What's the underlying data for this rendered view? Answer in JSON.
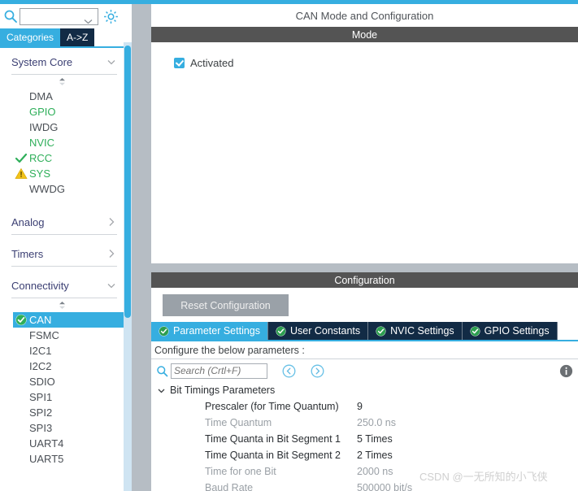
{
  "theme": {
    "accent": "#36aee0",
    "tab_dark": "#122b45",
    "section_bar": "#545454",
    "divider": "#b6bdc4",
    "green": "#2faf5a",
    "warning": "#f0c419"
  },
  "sidebar": {
    "search": {
      "value": "",
      "placeholder": ""
    },
    "gear_icon": "gear-icon",
    "tabs": [
      {
        "label": "Categories",
        "active": true
      },
      {
        "label": "A->Z",
        "active": false
      }
    ],
    "groups": [
      {
        "name": "System Core",
        "expanded": true,
        "items": [
          {
            "label": "DMA",
            "state": "none",
            "color": "#4a4f55"
          },
          {
            "label": "GPIO",
            "state": "none",
            "color": "#2faf5a"
          },
          {
            "label": "IWDG",
            "state": "none",
            "color": "#4a4f55"
          },
          {
            "label": "NVIC",
            "state": "none",
            "color": "#2faf5a"
          },
          {
            "label": "RCC",
            "state": "check",
            "color": "#2faf5a"
          },
          {
            "label": "SYS",
            "state": "warning",
            "color": "#2faf5a"
          },
          {
            "label": "WWDG",
            "state": "none",
            "color": "#4a4f55"
          }
        ]
      },
      {
        "name": "Analog",
        "expanded": false,
        "items": []
      },
      {
        "name": "Timers",
        "expanded": false,
        "items": []
      },
      {
        "name": "Connectivity",
        "expanded": true,
        "items": [
          {
            "label": "CAN",
            "state": "check-filled",
            "selected": true
          },
          {
            "label": "FSMC",
            "state": "none"
          },
          {
            "label": "I2C1",
            "state": "none"
          },
          {
            "label": "I2C2",
            "state": "none"
          },
          {
            "label": "SDIO",
            "state": "none"
          },
          {
            "label": "SPI1",
            "state": "none"
          },
          {
            "label": "SPI2",
            "state": "none"
          },
          {
            "label": "SPI3",
            "state": "none"
          },
          {
            "label": "UART4",
            "state": "none"
          },
          {
            "label": "UART5",
            "state": "none"
          }
        ]
      }
    ]
  },
  "main": {
    "title": "CAN Mode and Configuration",
    "mode": {
      "header": "Mode",
      "activated": {
        "label": "Activated",
        "checked": true
      }
    },
    "configuration": {
      "header": "Configuration",
      "reset_button": "Reset Configuration",
      "tabs": [
        {
          "label": "Parameter Settings",
          "active": true,
          "status": "ok"
        },
        {
          "label": "User Constants",
          "active": false,
          "status": "ok"
        },
        {
          "label": "NVIC Settings",
          "active": false,
          "status": "ok"
        },
        {
          "label": "GPIO Settings",
          "active": false,
          "status": "ok"
        }
      ],
      "note": "Configure the below parameters :",
      "search": {
        "value": "",
        "placeholder": "Search (Crtl+F)"
      },
      "nav_back_icon": "chevron-left-circle-icon",
      "nav_forward_icon": "chevron-right-circle-icon",
      "info_icon": "info-icon",
      "tree": {
        "group_label": "Bit Timings Parameters",
        "expanded": true,
        "rows": [
          {
            "label": "Prescaler (for Time Quantum)",
            "value": "9",
            "editable": true
          },
          {
            "label": "Time Quantum",
            "value": "250.0 ns",
            "editable": false
          },
          {
            "label": "Time Quanta in Bit Segment 1",
            "value": "5 Times",
            "editable": true
          },
          {
            "label": "Time Quanta in Bit Segment 2",
            "value": "2 Times",
            "editable": true
          },
          {
            "label": "Time for one Bit",
            "value": "2000 ns",
            "editable": false
          },
          {
            "label": "Baud Rate",
            "value": "500000 bit/s",
            "editable": false
          }
        ]
      }
    }
  },
  "watermark": {
    "text": "CSDN @一无所知的小飞侠"
  }
}
